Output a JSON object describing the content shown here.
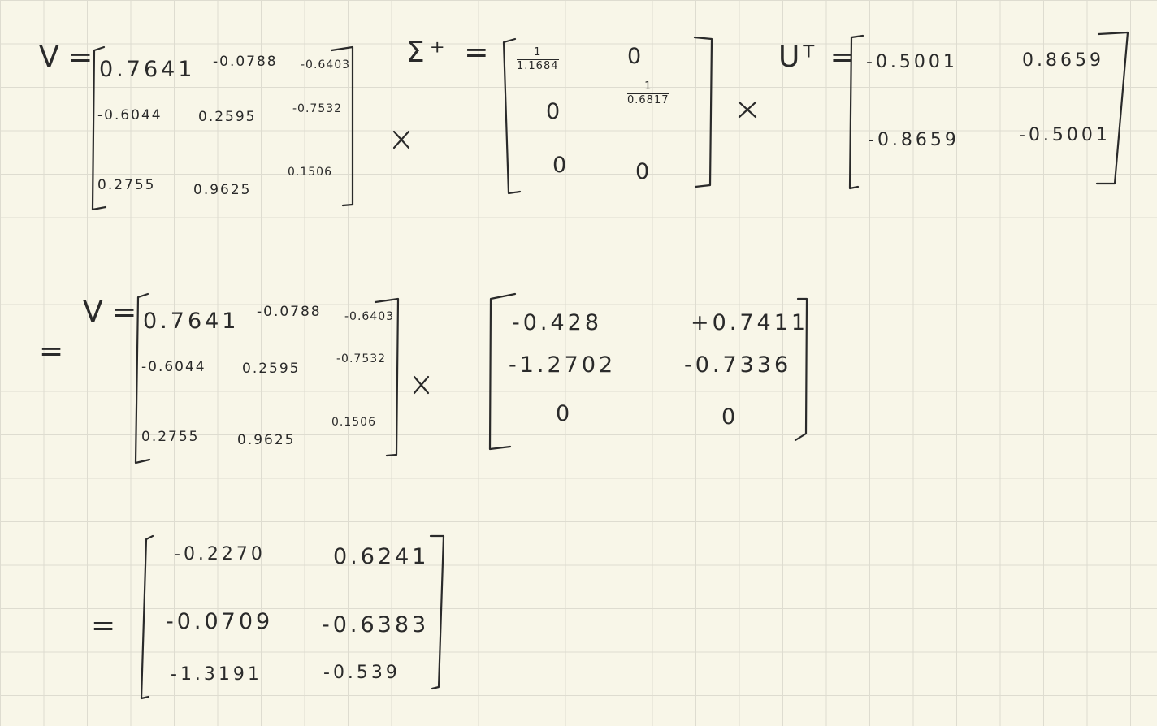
{
  "labels": {
    "v": "V =",
    "sigma_plus": "Σ⁺ =",
    "u_transpose": "Uᵀ =",
    "equals": "=",
    "times": "×"
  },
  "v_matrix": [
    [
      "0.7641",
      "-0.0788",
      "-0.6403"
    ],
    [
      "-0.6044",
      "0.2595",
      "-0.7532"
    ],
    [
      "0.2755",
      "0.9625",
      "0.1506"
    ]
  ],
  "sigma_plus": {
    "r1c1_num": "1",
    "r1c1_den": "1.1684",
    "r1c2": "0",
    "r2c1": "0",
    "r2c2_num": "1",
    "r2c2_den": "0.6817",
    "r3c1": "0",
    "r3c2": "0"
  },
  "u_transpose": [
    [
      "-0.5001",
      "0.8659"
    ],
    [
      "-0.8659",
      "-0.5001"
    ]
  ],
  "intermediate": [
    [
      "-0.428",
      "+0.7411"
    ],
    [
      "-1.2702",
      "-0.7336"
    ],
    [
      "0",
      "0"
    ]
  ],
  "result": [
    [
      "-0.2270",
      "0.6241"
    ],
    [
      "-0.0709",
      "-0.6383"
    ],
    [
      "-1.3191",
      "-0.539"
    ]
  ]
}
